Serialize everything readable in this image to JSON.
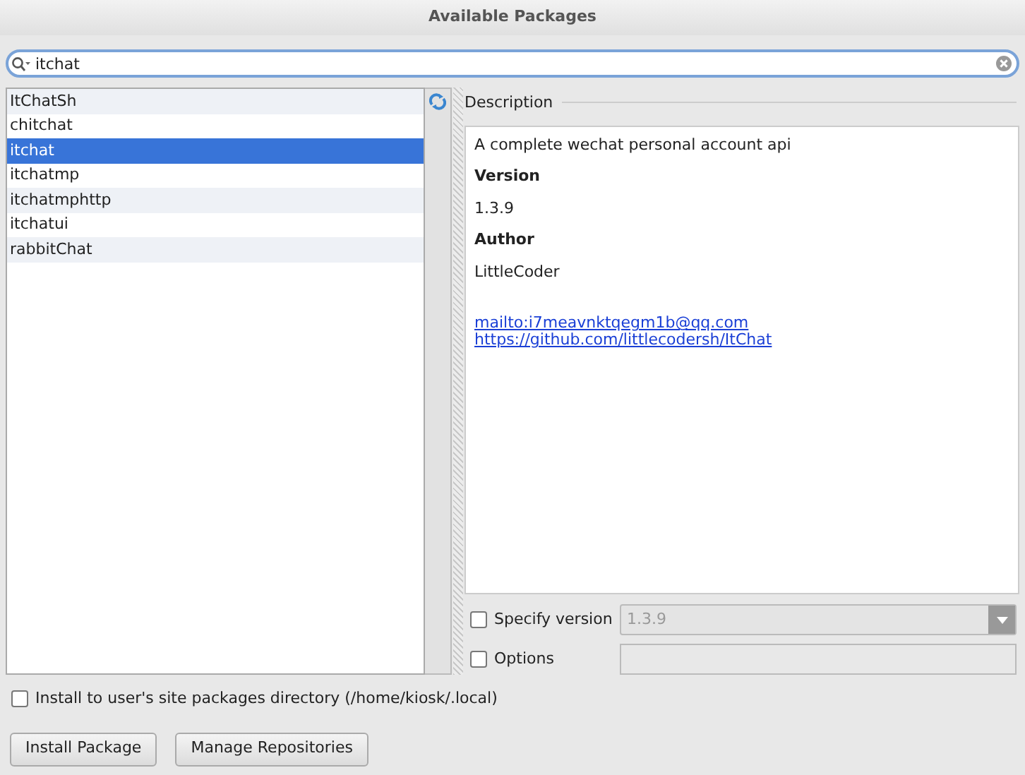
{
  "window": {
    "title": "Available Packages"
  },
  "search": {
    "value": "itchat"
  },
  "packages": [
    {
      "name": "ItChatSh",
      "selected": false
    },
    {
      "name": "chitchat",
      "selected": false
    },
    {
      "name": "itchat",
      "selected": true
    },
    {
      "name": "itchatmp",
      "selected": false
    },
    {
      "name": "itchatmphttp",
      "selected": false
    },
    {
      "name": "itchatui",
      "selected": false
    },
    {
      "name": "rabbitChat",
      "selected": false
    }
  ],
  "description": {
    "label": "Description",
    "summary": "A complete wechat personal account api",
    "version_label": "Version",
    "version": "1.3.9",
    "author_label": "Author",
    "author": "LittleCoder",
    "links": [
      "mailto:i7meavnktqegm1b@qq.com",
      "https://github.com/littlecodersh/ItChat"
    ]
  },
  "specify_version": {
    "label": "Specify version",
    "checked": false,
    "value": "1.3.9"
  },
  "options": {
    "label": "Options",
    "checked": false
  },
  "install_to_user": {
    "label": "Install to user's site packages directory (/home/kiosk/.local)",
    "checked": false
  },
  "buttons": [
    "Install Package",
    "Manage Repositories"
  ]
}
